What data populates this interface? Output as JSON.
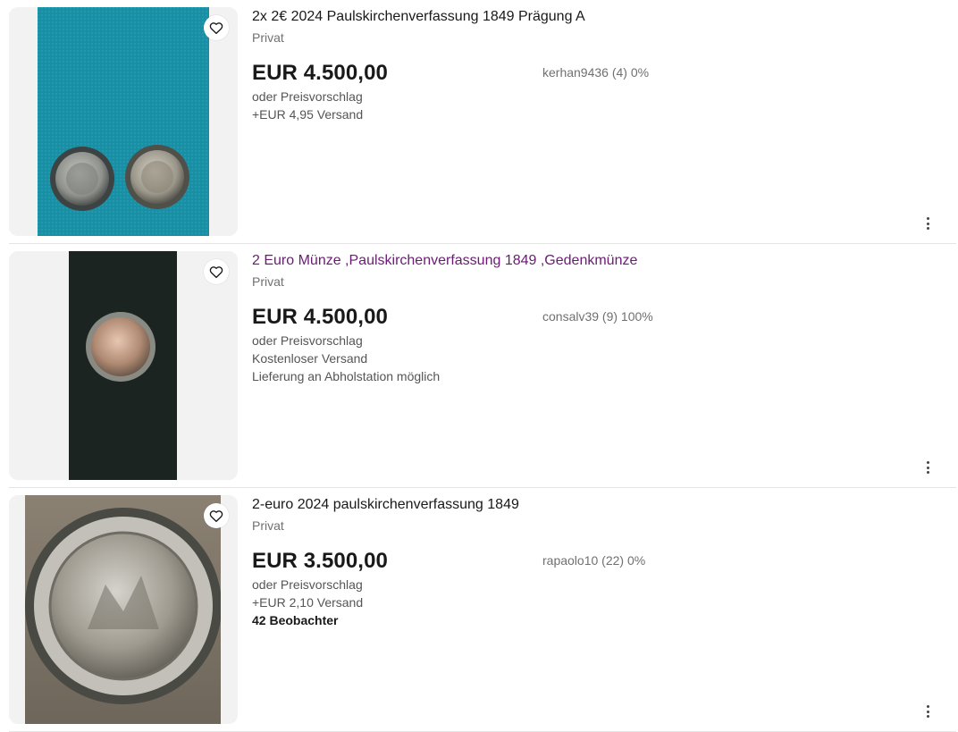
{
  "listings": [
    {
      "title": "2x 2€ 2024 Paulskirchenverfassung 1849 Prägung A",
      "subtitle": "Privat",
      "price": "EUR 4.500,00",
      "offer": "oder Preisvorschlag",
      "shipping": "+EUR 4,95 Versand",
      "seller": "kerhan9436 (4) 0%",
      "icons": [
        "heart-icon",
        "more-vertical-icon"
      ]
    },
    {
      "title": "2 Euro Münze ,Paulskirchenverfassung 1849 ,Gedenkmünze",
      "subtitle": "Privat",
      "price": "EUR 4.500,00",
      "offer": "oder Preisvorschlag",
      "shipping": "Kostenloser Versand",
      "pickup": "Lieferung an Abholstation möglich",
      "seller": "consalv39 (9) 100%",
      "title_color": "#6b1b74",
      "icons": [
        "heart-icon",
        "more-vertical-icon"
      ]
    },
    {
      "title": "2-euro 2024 paulskirchenverfassung 1849",
      "subtitle": "Privat",
      "price": "EUR 3.500,00",
      "offer": "oder Preisvorschlag",
      "shipping": "+EUR 2,10 Versand",
      "watchers": "42 Beobachter",
      "seller": "rapaolo10 (22) 0%",
      "icons": [
        "heart-icon",
        "more-vertical-icon"
      ]
    }
  ]
}
